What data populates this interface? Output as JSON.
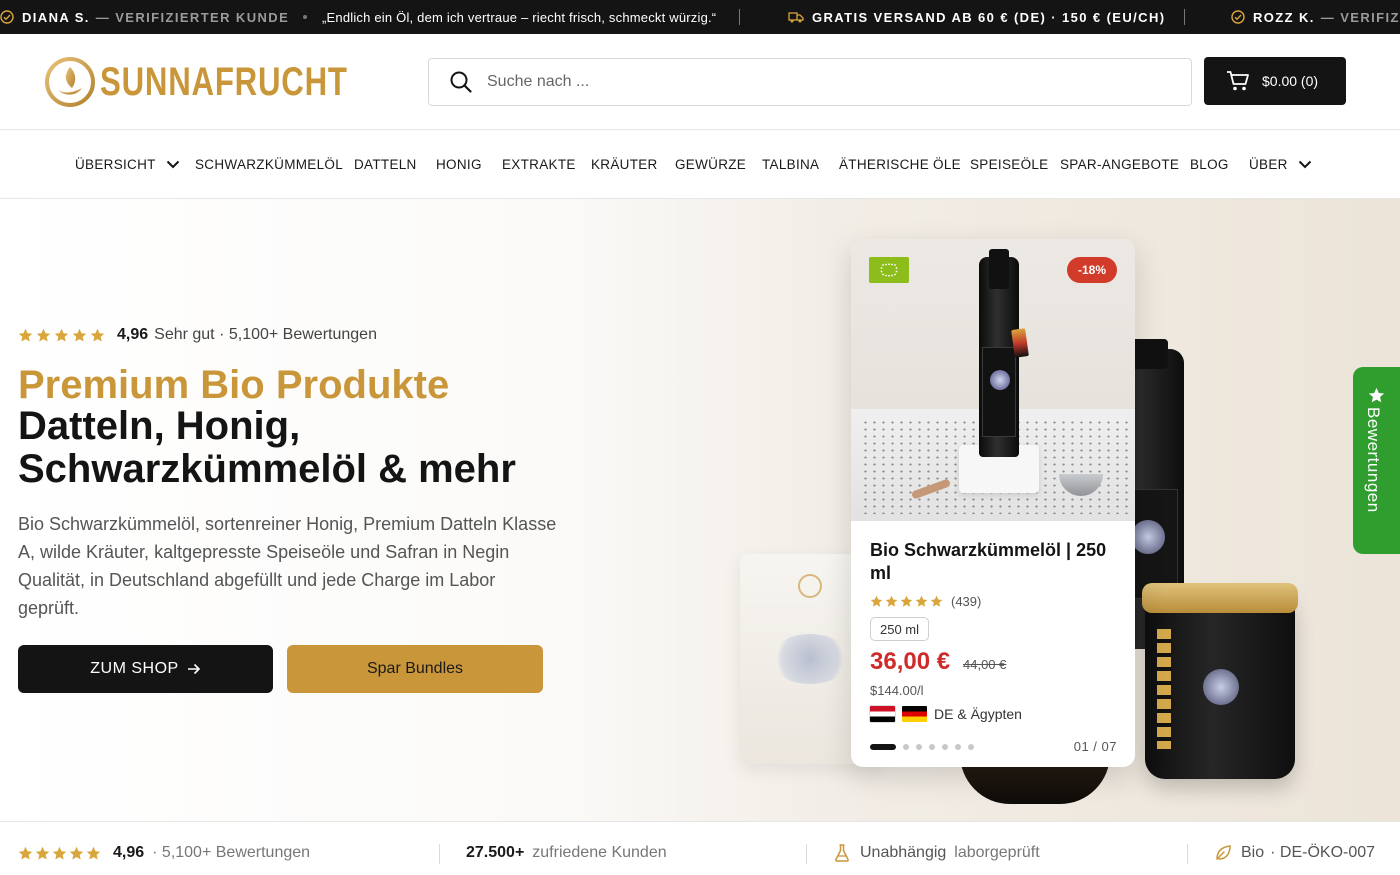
{
  "marquee": {
    "item1_name": "DIANA S.",
    "item1_tag": "— VERIFIZIERTER KUNDE",
    "item1_quote": "„Endlich ein Öl, dem ich vertraue – riecht frisch, schmeckt würzig.“",
    "item2_text": "GRATIS VERSAND AB 60 € (DE) · 150 € (EU/CH)",
    "item3_name": "ROZZ K.",
    "item3_tag": "— VERIFIZ"
  },
  "header": {
    "brand": "SUNNAFRUCHT",
    "search_placeholder": "Suche nach ...",
    "cart_label": "$0.00 (0)"
  },
  "nav": {
    "items": [
      {
        "label": "ÜBERSICHT",
        "has_dropdown": true
      },
      {
        "label": "SCHWARZKÜMMELÖL"
      },
      {
        "label": "DATTELN"
      },
      {
        "label": "HONIG"
      },
      {
        "label": "EXTRAKTE"
      },
      {
        "label": "KRÄUTER"
      },
      {
        "label": "GEWÜRZE"
      },
      {
        "label": "TALBINA"
      },
      {
        "label": "ÄTHERISCHE ÖLE"
      },
      {
        "label": "SPEISEÖLE"
      },
      {
        "label": "SPAR-ANGEBOTE"
      },
      {
        "label": "BLOG"
      },
      {
        "label": "ÜBER",
        "has_dropdown": true
      }
    ]
  },
  "hero": {
    "rating_score": "4,96",
    "rating_text": "Sehr gut · 5,100+ Bewertungen",
    "title_gold": "Premium Bio Produkte",
    "title_dark": "Datteln, Honig, Schwarzkümmelöl & mehr",
    "description": "Bio Schwarzkümmelöl, sortenreiner Honig, Premium Datteln Klasse A, wilde Kräuter, kaltgepresste Speiseöle und Safran in Negin Qualität, in Deutschland abgefüllt und jede Charge im Labor geprüft.",
    "btn_shop": "ZUM SHOP",
    "btn_bundles": "Spar Bundles"
  },
  "product_card": {
    "discount_badge": "-18%",
    "title": "Bio Schwarzkümmelöl | 250 ml",
    "review_count": "(439)",
    "stars": 5,
    "size": "250 ml",
    "price": "36,00 €",
    "old_price": "44,00 €",
    "unit_price": "$144.00/l",
    "origin": "DE & Ägypten",
    "slide_counter": "01 / 07",
    "slide_index": 1,
    "slide_total": 7
  },
  "reviews_tab": {
    "label": "Bewertungen"
  },
  "trust_bar": {
    "rating_score": "4,96",
    "rating_text": "· 5,100+ Bewertungen",
    "customers_count": "27.500+",
    "customers_text": "zufriedene Kunden",
    "lab_strong": "Unabhängig",
    "lab_text": "laborgeprüft",
    "bio_strong": "Bio",
    "bio_text": "· DE-ÖKO-007"
  },
  "colors": {
    "accent_gold": "#c9963a",
    "dark": "#141414",
    "sale_red": "#d23b2a",
    "reviews_green": "#2f9e2f",
    "star_gold": "#d9a63c"
  }
}
